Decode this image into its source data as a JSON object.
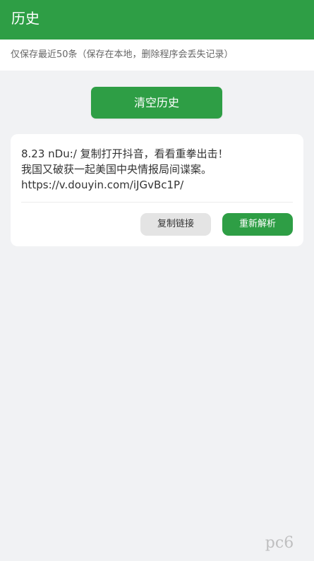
{
  "header": {
    "title": "历史"
  },
  "notice": {
    "text": "仅保存最近50条（保存在本地，删除程序会丢失记录）"
  },
  "actions": {
    "clear_history_label": "清空历史"
  },
  "history": {
    "items": [
      {
        "lines": [
          "8.23 nDu:/ 复制打开抖音，看看重拳出击！",
          "我国又破获一起美国中央情报局间谍案。",
          "https://v.douyin.com/iJGvBc1P/"
        ],
        "copy_label": "复制链接",
        "reparse_label": "重新解析"
      }
    ]
  },
  "watermark": {
    "text": "pc6"
  },
  "colors": {
    "accent": "#2e9e45",
    "background": "#f1f2f4",
    "card": "#ffffff",
    "secondary_button": "#e4e4e4"
  }
}
